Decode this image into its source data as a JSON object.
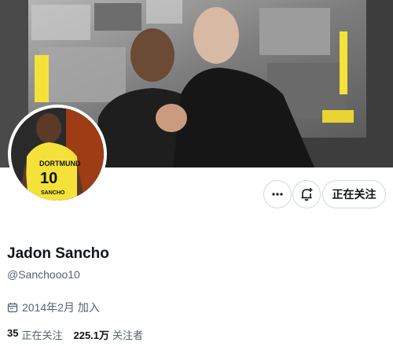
{
  "profile": {
    "display_name": "Jadon Sancho",
    "handle": "@Sanchooo10",
    "joined": "2014年2月 加入",
    "following_count": "35",
    "following_label": "正在关注",
    "followers_count": "225.1万",
    "followers_label": "关注者",
    "jersey_text": "DORTMUND",
    "jersey_number": "10",
    "jersey_lower_text": "SANCHO"
  },
  "actions": {
    "more_icon": "more-horizontal-icon",
    "notify_icon": "bell-plus-icon",
    "follow_label": "正在关注"
  },
  "colors": {
    "text_primary": "#0f1419",
    "text_secondary": "#536471",
    "border": "#cfd9de",
    "bvb_yellow": "#f4e23a"
  }
}
